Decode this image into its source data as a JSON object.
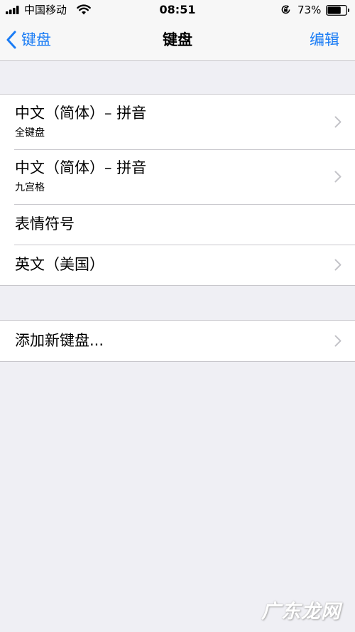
{
  "status_bar": {
    "carrier": "中国移动",
    "time": "08:51",
    "battery": "73%",
    "battery_level": 0.73
  },
  "nav": {
    "back_label": "键盘",
    "title": "键盘",
    "edit_label": "编辑"
  },
  "keyboards": [
    {
      "title": "中文（简体）– 拼音",
      "subtitle": "全键盘"
    },
    {
      "title": "中文（简体）– 拼音",
      "subtitle": "九宫格"
    },
    {
      "title": "表情符号"
    },
    {
      "title": "英文（美国）"
    }
  ],
  "add_keyboard": {
    "title": "添加新键盘..."
  },
  "watermark": {
    "text": "广东龙网"
  },
  "colors": {
    "accent": "#1a7cf5",
    "background": "#efeff4",
    "separator": "#c8c7cc",
    "chevron": "#c4c4c9"
  }
}
